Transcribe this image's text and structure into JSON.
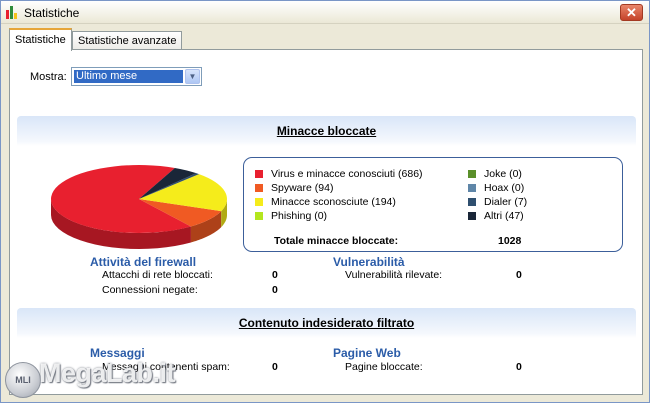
{
  "window": {
    "title": "Statistiche",
    "close_glyph": "✕"
  },
  "tabs": [
    {
      "label": "Statistiche",
      "active": true
    },
    {
      "label": "Statistiche avanzate",
      "active": false
    }
  ],
  "filter": {
    "label": "Mostra:",
    "selected": "Ultimo mese",
    "arrow_glyph": "▼"
  },
  "threats": {
    "title": "Minacce bloccate",
    "legend": [
      {
        "label": "Virus e minacce conosciuti (686)",
        "color": "#e8202f",
        "icon": "red-square"
      },
      {
        "label": "Spyware (94)",
        "color": "#f05a23",
        "icon": "orange-square"
      },
      {
        "label": "Minacce sconosciute (194)",
        "color": "#f5ec1b",
        "icon": "yellow-square"
      },
      {
        "label": "Phishing (0)",
        "color": "#b4e61e",
        "icon": "lime-square"
      },
      {
        "label": "Joke (0)",
        "color": "#5a8f2a",
        "icon": "green-square"
      },
      {
        "label": "Hoax (0)",
        "color": "#5f86a8",
        "icon": "steel-blue-square"
      },
      {
        "label": "Dialer (7)",
        "color": "#2f4f6f",
        "icon": "navy-square"
      },
      {
        "label": "Altri (47)",
        "color": "#1a2638",
        "icon": "dark-navy-square"
      }
    ],
    "total_label": "Totale minacce bloccate:",
    "total_value": "1028"
  },
  "firewall": {
    "title": "Attività del firewall",
    "rows": [
      {
        "label": "Attacchi di rete bloccati:",
        "value": "0"
      },
      {
        "label": "Connessioni negate:",
        "value": "0"
      }
    ]
  },
  "vulnerability": {
    "title": "Vulnerabilità",
    "rows": [
      {
        "label": "Vulnerabilità rilevate:",
        "value": "0"
      }
    ]
  },
  "filtered": {
    "title": "Contenuto indesiderato filtrato",
    "messages": {
      "title": "Messaggi",
      "label": "Messaggi contenenti spam:",
      "value": "0"
    },
    "web": {
      "title": "Pagine Web",
      "label": "Pagine bloccate:",
      "value": "0"
    }
  },
  "watermark": {
    "badge": "MLI",
    "text": "MegaLab.it"
  },
  "colors": {
    "accent_blue": "#2b5ca8",
    "selection": "#316ac5"
  },
  "chart_data": {
    "type": "pie",
    "categories": [
      "Virus e minacce conosciuti",
      "Spyware",
      "Minacce sconosciute",
      "Phishing",
      "Joke",
      "Hoax",
      "Dialer",
      "Altri"
    ],
    "values": [
      686,
      94,
      194,
      0,
      0,
      0,
      7,
      47
    ],
    "colors": [
      "#e8202f",
      "#f05a23",
      "#f5ec1b",
      "#b4e61e",
      "#5a8f2a",
      "#5f86a8",
      "#2f4f6f",
      "#1a2638"
    ],
    "title": "",
    "style": "3d-tilted"
  }
}
